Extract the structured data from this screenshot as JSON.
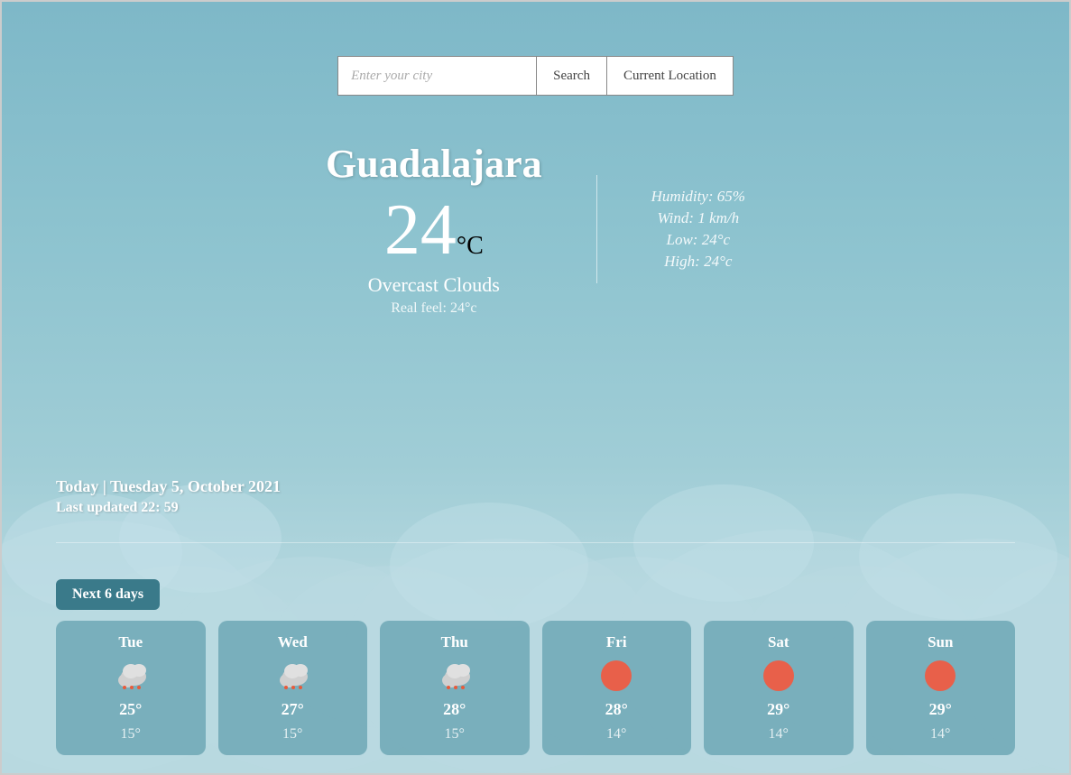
{
  "search": {
    "placeholder": "Enter your city",
    "search_label": "Search",
    "location_label": "Current Location"
  },
  "current_weather": {
    "city": "Guadalajara",
    "temperature": "24",
    "unit": "°C",
    "condition": "Overcast Clouds",
    "real_feel_label": "Real feel:",
    "real_feel_value": "24°c",
    "humidity_label": "Humidity:",
    "humidity_value": "65%",
    "wind_label": "Wind:",
    "wind_value": "1 km/h",
    "low_label": "Low:",
    "low_value": "24°c",
    "high_label": "High:",
    "high_value": "24°c"
  },
  "date_info": {
    "today_label": "Today | Tuesday 5, October 2021",
    "last_updated_label": "Last updated 22: 59"
  },
  "forecast": {
    "section_label": "Next 6 days",
    "days": [
      {
        "name": "Tue",
        "high": "25°",
        "low": "15°",
        "icon": "rain-cloud"
      },
      {
        "name": "Wed",
        "high": "27°",
        "low": "15°",
        "icon": "rain-cloud"
      },
      {
        "name": "Thu",
        "high": "28°",
        "low": "15°",
        "icon": "rain-cloud"
      },
      {
        "name": "Fri",
        "high": "28°",
        "low": "14°",
        "icon": "sun"
      },
      {
        "name": "Sat",
        "high": "29°",
        "low": "14°",
        "icon": "sun"
      },
      {
        "name": "Sun",
        "high": "29°",
        "low": "14°",
        "icon": "sun"
      }
    ]
  }
}
